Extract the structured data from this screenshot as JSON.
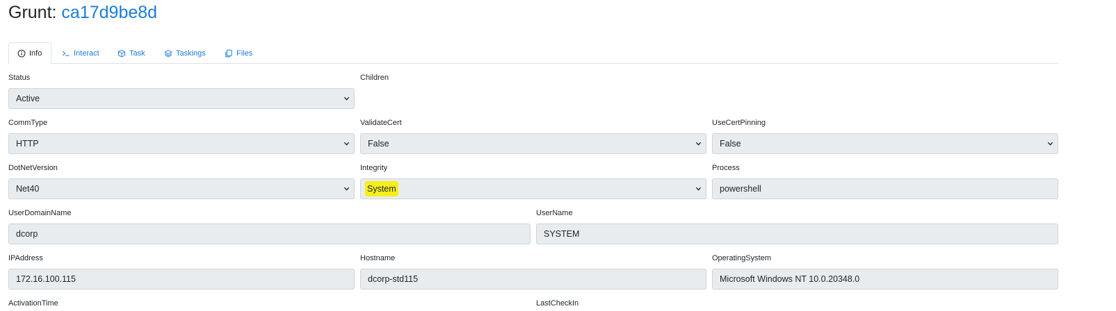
{
  "title": {
    "prefix": "Grunt: ",
    "id": "ca17d9be8d"
  },
  "tabs": [
    {
      "label": "Info",
      "icon": "info-circle-icon",
      "active": true
    },
    {
      "label": "Interact",
      "icon": "terminal-prompt-icon",
      "active": false
    },
    {
      "label": "Task",
      "icon": "box-icon",
      "active": false
    },
    {
      "label": "Taskings",
      "icon": "layers-icon",
      "active": false
    },
    {
      "label": "Files",
      "icon": "files-icon",
      "active": false
    }
  ],
  "fields": {
    "status": {
      "label": "Status",
      "value": "Active"
    },
    "children": {
      "label": "Children"
    },
    "comm_type": {
      "label": "CommType",
      "value": "HTTP"
    },
    "validate_cert": {
      "label": "ValidateCert",
      "value": "False"
    },
    "use_cert_pinning": {
      "label": "UseCertPinning",
      "value": "False"
    },
    "dotnet_version": {
      "label": "DotNetVersion",
      "value": "Net40"
    },
    "integrity": {
      "label": "Integrity",
      "value": "System"
    },
    "process": {
      "label": "Process",
      "value": "powershell"
    },
    "user_domain_name": {
      "label": "UserDomainName",
      "value": "dcorp"
    },
    "user_name": {
      "label": "UserName",
      "value": "SYSTEM"
    },
    "ip_address": {
      "label": "IPAddress",
      "value": "172.16.100.115"
    },
    "hostname": {
      "label": "Hostname",
      "value": "dcorp-std115"
    },
    "operating_system": {
      "label": "OperatingSystem",
      "value": "Microsoft Windows NT 10.0.20348.0"
    },
    "activation_time": {
      "label": "ActivationTime"
    },
    "last_check_in": {
      "label": "LastCheckIn"
    }
  },
  "colors": {
    "link": "#1a7bdc",
    "highlight": "#f5ef1a",
    "field_bg": "#e9ecef"
  }
}
